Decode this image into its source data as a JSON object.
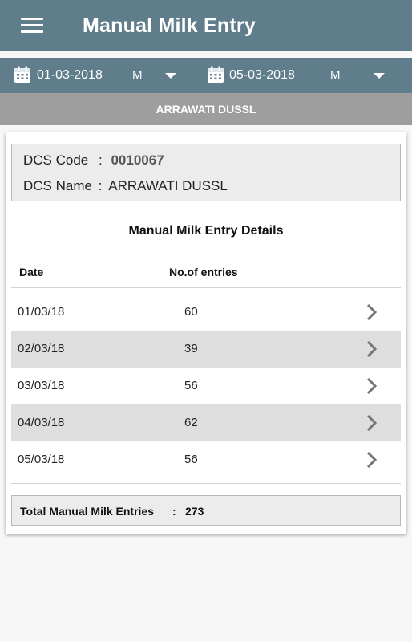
{
  "app": {
    "title": "Manual Milk Entry"
  },
  "filters": {
    "from_date": "01-03-2018",
    "from_shift": "M",
    "to_date": "05-03-2018",
    "to_shift": "M"
  },
  "subheader": "ARRAWATI DUSSL",
  "dcs": {
    "code_label": "DCS Code",
    "code_sep": ":",
    "code_value": "0010067",
    "name_label": "DCS Name",
    "name_sep": ":",
    "name_value": "ARRAWATI DUSSL"
  },
  "details": {
    "title": "Manual Milk Entry Details",
    "col_date": "Date",
    "col_entries": "No.of entries",
    "rows": [
      {
        "date": "01/03/18",
        "entries": "60"
      },
      {
        "date": "02/03/18",
        "entries": "39"
      },
      {
        "date": "03/03/18",
        "entries": "56"
      },
      {
        "date": "04/03/18",
        "entries": "62"
      },
      {
        "date": "05/03/18",
        "entries": "56"
      }
    ]
  },
  "total": {
    "label": "Total Manual Milk Entries",
    "sep": ":",
    "value": "273"
  },
  "colors": {
    "appbar": "#5f7d8b",
    "subheader": "#9e9e9e",
    "row_alt": "#dedede"
  }
}
